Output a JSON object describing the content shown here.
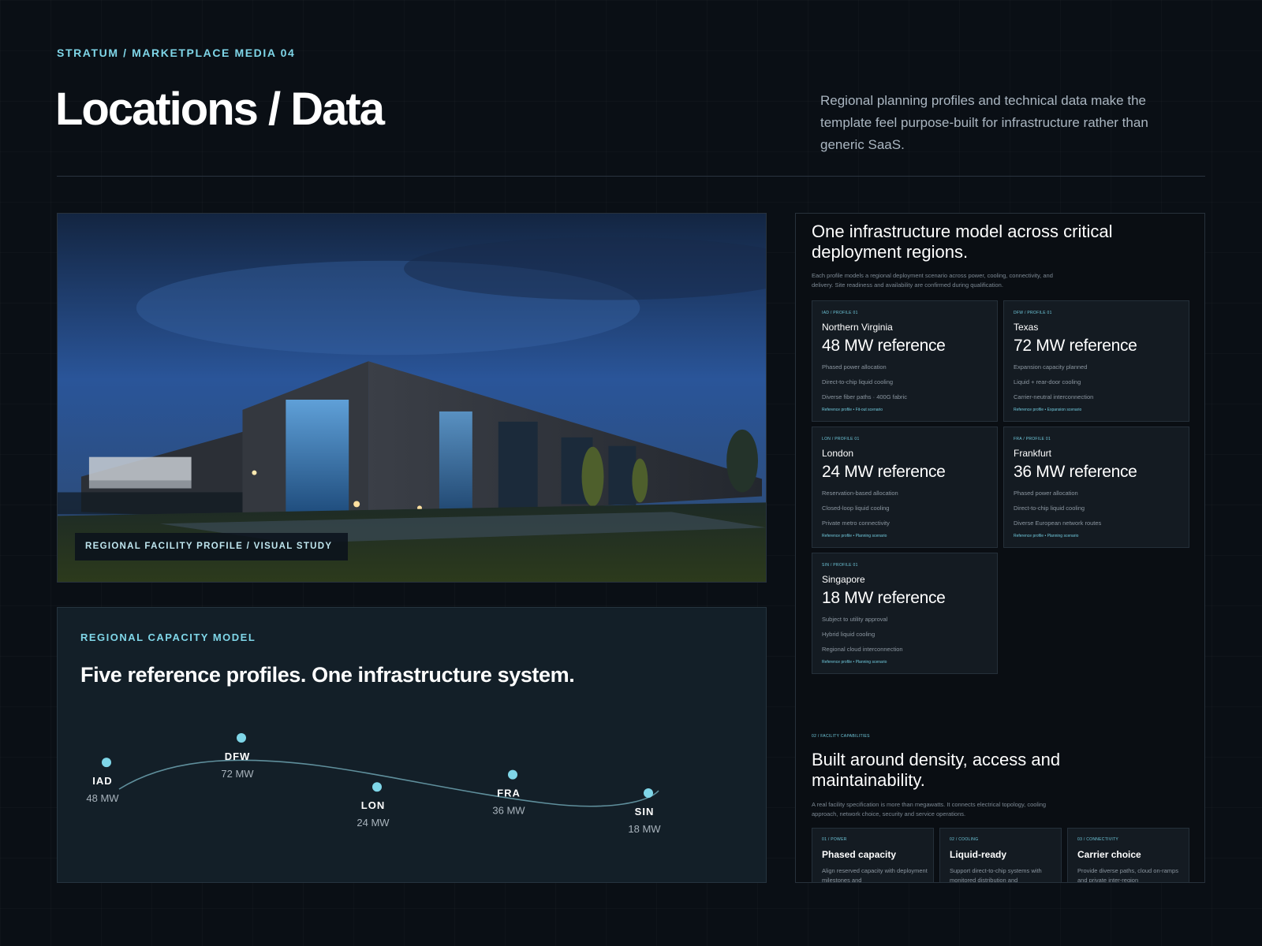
{
  "header": {
    "eyebrow": "STRATUM / MARKETPLACE MEDIA 04",
    "title": "Locations / Data",
    "intro": "Regional planning profiles and technical data make the template feel purpose-built for infrastructure rather than generic SaaS."
  },
  "hero": {
    "caption": "REGIONAL FACILITY PROFILE / VISUAL STUDY"
  },
  "capacity_model": {
    "eyebrow": "REGIONAL CAPACITY MODEL",
    "title": "Five reference profiles. One infrastructure system.",
    "colors": {
      "point": "#7fd6e8",
      "curve": "#5f8f9c"
    }
  },
  "chart_data": {
    "type": "line",
    "title": "Five reference profiles. One infrastructure system.",
    "categories": [
      "IAD",
      "DFW",
      "LON",
      "FRA",
      "SIN"
    ],
    "series": [
      {
        "values": [
          48,
          72,
          24,
          36,
          18
        ],
        "value_labels": [
          "48 MW",
          "72 MW",
          "24 MW",
          "36 MW",
          "18 MW"
        ]
      }
    ],
    "unit": "MW",
    "grid": false
  },
  "regions_panel": {
    "title": "One infrastructure model across critical deployment regions.",
    "description": "Each profile models a regional deployment scenario across power, cooling, connectivity, and delivery. Site readiness and availability are confirmed during qualification.",
    "profiles": [
      {
        "code": "IAD / PROFILE 01",
        "name": "Northern Virginia",
        "capacity": "48 MW reference",
        "lines": [
          "Phased power allocation",
          "Direct-to-chip liquid cooling",
          "Diverse fiber paths · 400G fabric"
        ],
        "footer": "Reference profile • Fit-out scenario"
      },
      {
        "code": "DFW / PROFILE 01",
        "name": "Texas",
        "capacity": "72 MW reference",
        "lines": [
          "Expansion capacity planned",
          "Liquid + rear-door cooling",
          "Carrier-neutral interconnection"
        ],
        "footer": "Reference profile • Expansion scenario"
      },
      {
        "code": "LON / PROFILE 01",
        "name": "London",
        "capacity": "24 MW reference",
        "lines": [
          "Reservation-based allocation",
          "Closed-loop liquid cooling",
          "Private metro connectivity"
        ],
        "footer": "Reference profile • Planning scenario"
      },
      {
        "code": "FRA / PROFILE 01",
        "name": "Frankfurt",
        "capacity": "36 MW reference",
        "lines": [
          "Phased power allocation",
          "Direct-to-chip liquid cooling",
          "Diverse European network routes"
        ],
        "footer": "Reference profile • Planning scenario"
      },
      {
        "code": "SIN / PROFILE 01",
        "name": "Singapore",
        "capacity": "18 MW reference",
        "lines": [
          "Subject to utility approval",
          "Hybrid liquid cooling",
          "Regional cloud interconnection"
        ],
        "footer": "Reference profile • Planning scenario"
      }
    ],
    "capabilities": {
      "code": "02 / FACILITY CAPABILITIES",
      "title": "Built around density, access and maintainability.",
      "description": "A real facility specification is more than megawatts. It connects electrical topology, cooling approach, network choice, security and service operations.",
      "cards": [
        {
          "code": "01 / POWER",
          "title": "Phased capacity",
          "text": "Align reserved capacity with deployment milestones and"
        },
        {
          "code": "02 / COOLING",
          "title": "Liquid-ready",
          "text": "Support direct-to-chip systems with monitored distribution and"
        },
        {
          "code": "03 / CONNECTIVITY",
          "title": "Carrier choice",
          "text": "Provide diverse paths, cloud on-ramps and private inter-region"
        }
      ]
    }
  }
}
